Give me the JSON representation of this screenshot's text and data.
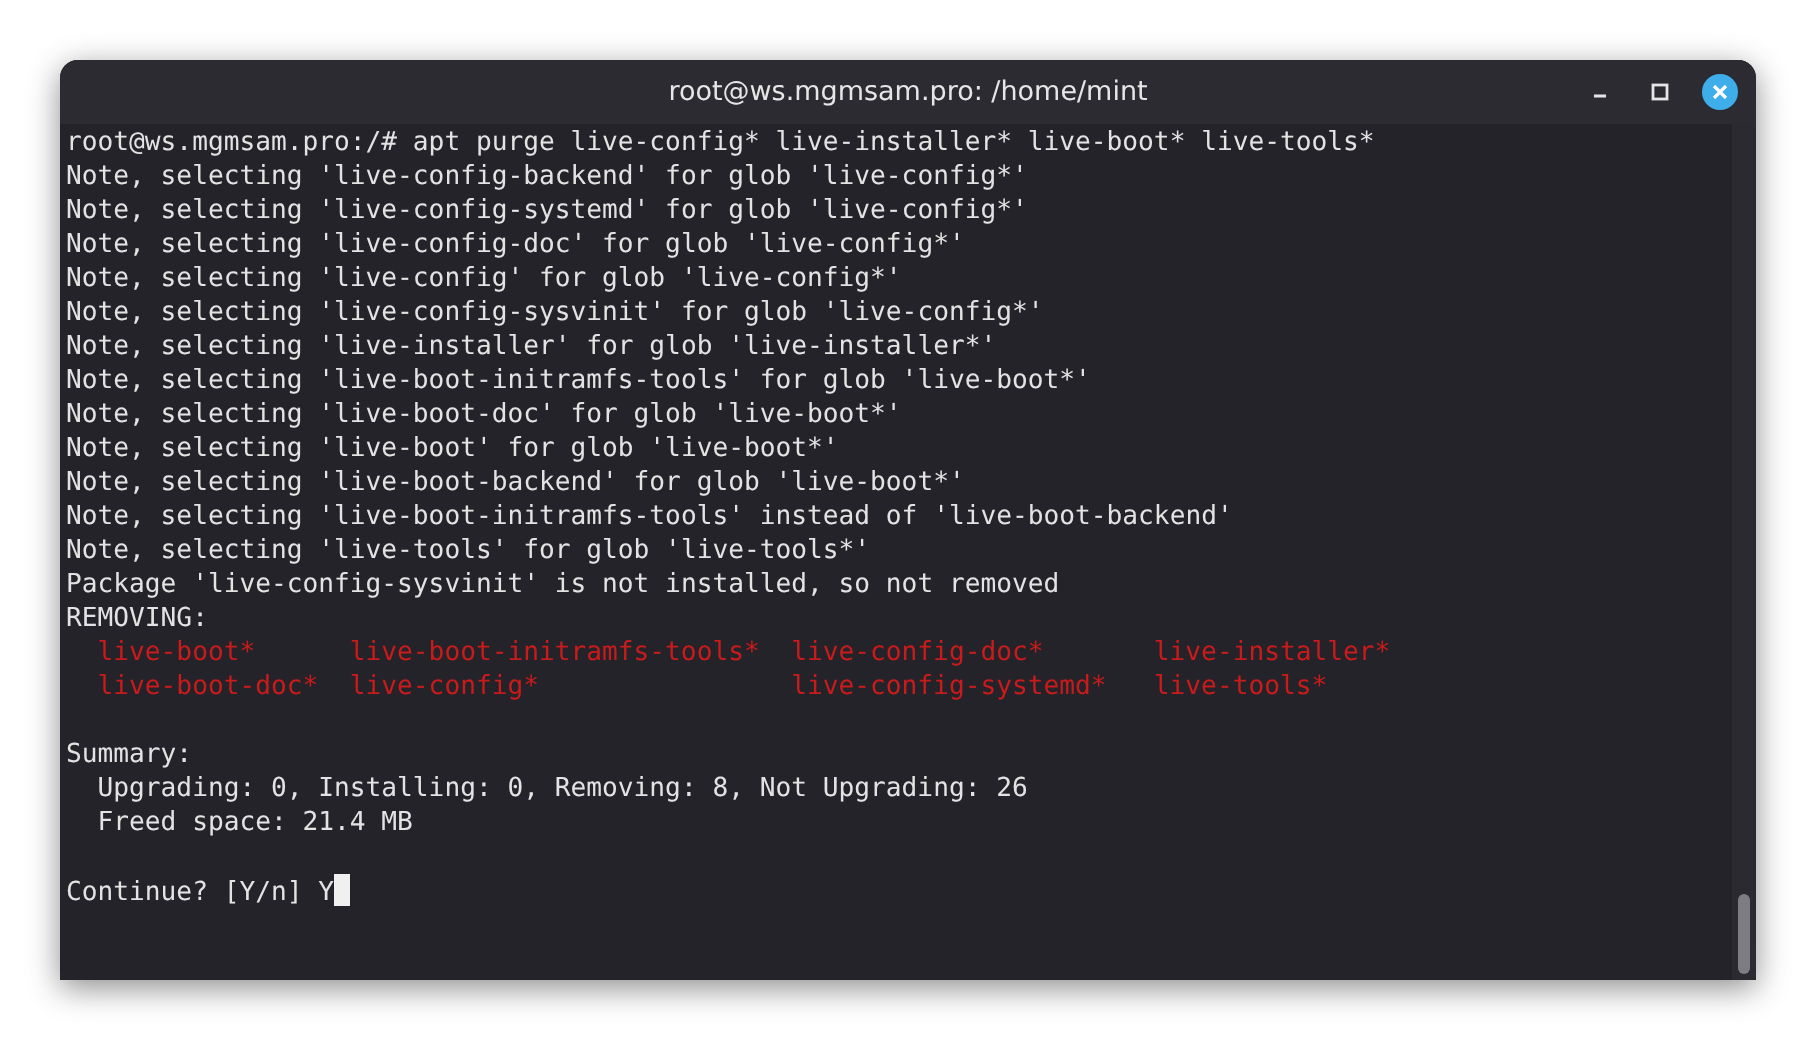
{
  "window": {
    "title": "root@ws.mgmsam.pro: /home/mint"
  },
  "terminal": {
    "lines": [
      {
        "kind": "text",
        "text": "root@ws.mgmsam.pro:/# apt purge live-config* live-installer* live-boot* live-tools*"
      },
      {
        "kind": "text",
        "text": "Note, selecting 'live-config-backend' for glob 'live-config*'"
      },
      {
        "kind": "text",
        "text": "Note, selecting 'live-config-systemd' for glob 'live-config*'"
      },
      {
        "kind": "text",
        "text": "Note, selecting 'live-config-doc' for glob 'live-config*'"
      },
      {
        "kind": "text",
        "text": "Note, selecting 'live-config' for glob 'live-config*'"
      },
      {
        "kind": "text",
        "text": "Note, selecting 'live-config-sysvinit' for glob 'live-config*'"
      },
      {
        "kind": "text",
        "text": "Note, selecting 'live-installer' for glob 'live-installer*'"
      },
      {
        "kind": "text",
        "text": "Note, selecting 'live-boot-initramfs-tools' for glob 'live-boot*'"
      },
      {
        "kind": "text",
        "text": "Note, selecting 'live-boot-doc' for glob 'live-boot*'"
      },
      {
        "kind": "text",
        "text": "Note, selecting 'live-boot' for glob 'live-boot*'"
      },
      {
        "kind": "text",
        "text": "Note, selecting 'live-boot-backend' for glob 'live-boot*'"
      },
      {
        "kind": "text",
        "text": "Note, selecting 'live-boot-initramfs-tools' instead of 'live-boot-backend'"
      },
      {
        "kind": "text",
        "text": "Note, selecting 'live-tools' for glob 'live-tools*'"
      },
      {
        "kind": "text",
        "text": "Package 'live-config-sysvinit' is not installed, so not removed"
      },
      {
        "kind": "text",
        "text": "REMOVING:"
      },
      {
        "kind": "packages",
        "items": [
          "live-boot*",
          "live-boot-initramfs-tools*",
          "live-config-doc*",
          "live-installer*"
        ]
      },
      {
        "kind": "packages",
        "items": [
          "live-boot-doc*",
          "live-config*",
          "live-config-systemd*",
          "live-tools*"
        ]
      },
      {
        "kind": "blank"
      },
      {
        "kind": "text",
        "text": "Summary:"
      },
      {
        "kind": "indented",
        "text": "Upgrading: 0, Installing: 0, Removing: 8, Not Upgrading: 26"
      },
      {
        "kind": "indented",
        "text": "Freed space: 21.4 MB"
      },
      {
        "kind": "blank"
      },
      {
        "kind": "prompt",
        "text": "Continue? [Y/n]",
        "answer": "Y"
      }
    ]
  }
}
